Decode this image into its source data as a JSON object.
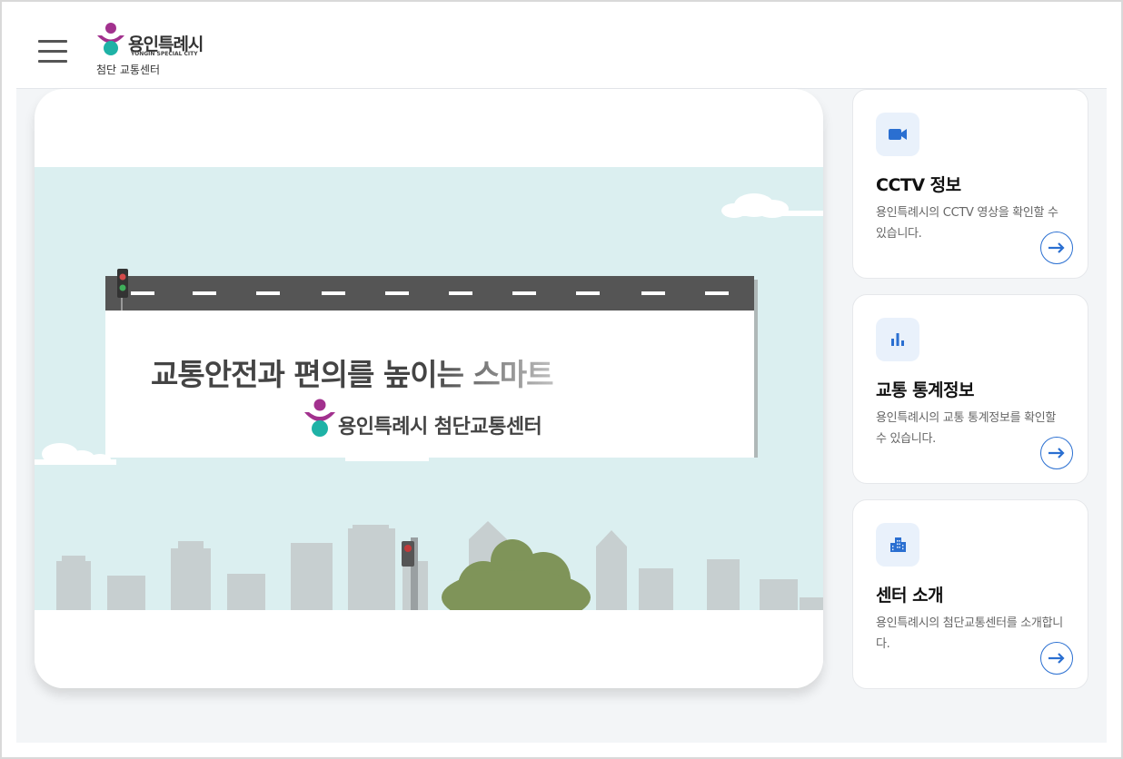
{
  "header": {
    "menu_icon": "hamburger-menu-icon",
    "logo_ko": "용인특례시",
    "logo_en": "YONGIN SPECIAL CITY",
    "subtitle": "첨단 교통센터"
  },
  "hero": {
    "banner_text": "교통안전과 편의를 높이는 스마트",
    "sign_text": "용인특례시 첨단교통센터"
  },
  "cards": [
    {
      "icon": "video-camera-icon",
      "title": "CCTV 정보",
      "desc": "용인특례시의 CCTV 영상을 확인할 수 있습니다.",
      "arrow_icon": "arrow-right-icon"
    },
    {
      "icon": "bar-chart-icon",
      "title": "교통 통계정보",
      "desc": "용인특례시의 교통 통계정보를 확인할 수 있습니다.",
      "arrow_icon": "arrow-right-icon"
    },
    {
      "icon": "building-icon",
      "title": "센터 소개",
      "desc": "용인특례시의 첨단교통센터를 소개합니다.",
      "arrow_icon": "arrow-right-icon"
    }
  ],
  "colors": {
    "accent": "#2a6fd1",
    "brand_purple": "#a2318e",
    "brand_teal": "#1eb2a6",
    "sky": "#dbeff0",
    "road": "#555555",
    "tree": "#7f9459",
    "building": "#c7cfd0"
  }
}
